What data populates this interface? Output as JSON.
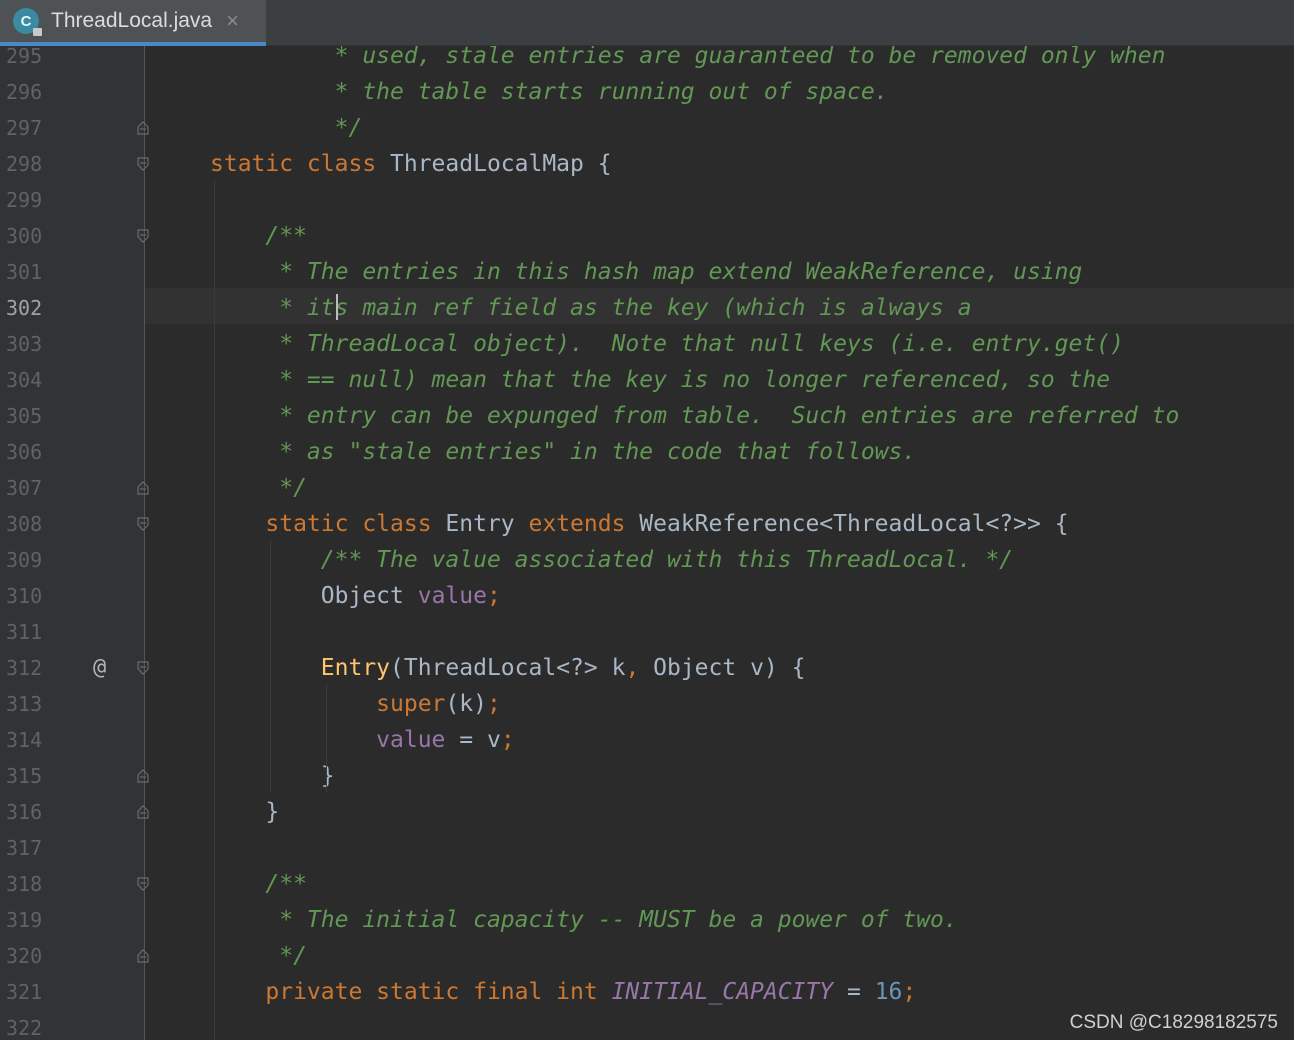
{
  "tab": {
    "title": "ThreadLocal.java",
    "icon": "java-class-lock-icon",
    "icon_letter": "C"
  },
  "watermark": "CSDN @C18298182575",
  "colors": {
    "keyword": "#cc7832",
    "comment": "#629755",
    "field": "#9876aa",
    "method": "#ffc66d",
    "number": "#6897bb",
    "text": "#a9b7c6",
    "background": "#2b2b2b"
  },
  "editor": {
    "current_line": "302",
    "lines": [
      {
        "num": "295",
        "tokens": [
          [
            "cm",
            "         * used, stale entries are guaranteed to be removed only when"
          ]
        ]
      },
      {
        "num": "296",
        "tokens": [
          [
            "cm",
            "         * the table starts running out of space."
          ]
        ]
      },
      {
        "num": "297",
        "tokens": [
          [
            "cm",
            "         */"
          ]
        ]
      },
      {
        "num": "298",
        "tokens": [
          [
            "kw",
            "static class "
          ],
          [
            "",
            "ThreadLocalMap {"
          ]
        ]
      },
      {
        "num": "299",
        "tokens": []
      },
      {
        "num": "300",
        "tokens": [
          [
            "cm",
            "    /**"
          ]
        ]
      },
      {
        "num": "301",
        "tokens": [
          [
            "cm",
            "     * The entries in this hash map extend WeakReference, using"
          ]
        ]
      },
      {
        "num": "302",
        "tokens": [
          [
            "cm",
            "     * its main ref field as the key (which is always a"
          ]
        ]
      },
      {
        "num": "303",
        "tokens": [
          [
            "cm",
            "     * ThreadLocal object).  Note that null keys (i.e. entry.get()"
          ]
        ]
      },
      {
        "num": "304",
        "tokens": [
          [
            "cm",
            "     * == null) mean that the key is no longer referenced, so the"
          ]
        ]
      },
      {
        "num": "305",
        "tokens": [
          [
            "cm",
            "     * entry can be expunged from table.  Such entries are referred to"
          ]
        ]
      },
      {
        "num": "306",
        "tokens": [
          [
            "cm",
            "     * as \"stale entries\" in the code that follows."
          ]
        ]
      },
      {
        "num": "307",
        "tokens": [
          [
            "cm",
            "     */"
          ]
        ]
      },
      {
        "num": "308",
        "tokens": [
          [
            "",
            "    "
          ],
          [
            "kw",
            "static class "
          ],
          [
            "",
            "Entry "
          ],
          [
            "kw",
            "extends "
          ],
          [
            "",
            "WeakReference<ThreadLocal<?>> {"
          ]
        ]
      },
      {
        "num": "309",
        "tokens": [
          [
            "cm",
            "        /** The value associated with this ThreadLocal. */"
          ]
        ]
      },
      {
        "num": "310",
        "tokens": [
          [
            "",
            "        Object "
          ],
          [
            "fld",
            "value"
          ],
          [
            "kw",
            ";"
          ]
        ]
      },
      {
        "num": "311",
        "tokens": []
      },
      {
        "num": "312",
        "tokens": [
          [
            "",
            "        "
          ],
          [
            "fn",
            "Entry"
          ],
          [
            "",
            "(ThreadLocal<?> k"
          ],
          [
            "kw",
            ", "
          ],
          [
            "",
            "Object v) {"
          ]
        ]
      },
      {
        "num": "313",
        "tokens": [
          [
            "",
            "            "
          ],
          [
            "kw",
            "super"
          ],
          [
            "",
            "(k)"
          ],
          [
            "kw",
            ";"
          ]
        ]
      },
      {
        "num": "314",
        "tokens": [
          [
            "",
            "            "
          ],
          [
            "fld",
            "value"
          ],
          [
            "",
            " = v"
          ],
          [
            "kw",
            ";"
          ]
        ]
      },
      {
        "num": "315",
        "tokens": [
          [
            "",
            "        }"
          ]
        ]
      },
      {
        "num": "316",
        "tokens": [
          [
            "",
            "    }"
          ]
        ]
      },
      {
        "num": "317",
        "tokens": []
      },
      {
        "num": "318",
        "tokens": [
          [
            "cm",
            "    /**"
          ]
        ]
      },
      {
        "num": "319",
        "tokens": [
          [
            "cm",
            "     * The initial capacity -- MUST be a power of two."
          ]
        ]
      },
      {
        "num": "320",
        "tokens": [
          [
            "cm",
            "     */"
          ]
        ]
      },
      {
        "num": "321",
        "tokens": [
          [
            "",
            "    "
          ],
          [
            "kw",
            "private static final int "
          ],
          [
            "cfld",
            "INITIAL_CAPACITY"
          ],
          [
            "",
            " = "
          ],
          [
            "num",
            "16"
          ],
          [
            "kw",
            ";"
          ]
        ]
      },
      {
        "num": "322",
        "tokens": []
      }
    ],
    "annotation_symbol": "@",
    "annotation_line": "312"
  }
}
